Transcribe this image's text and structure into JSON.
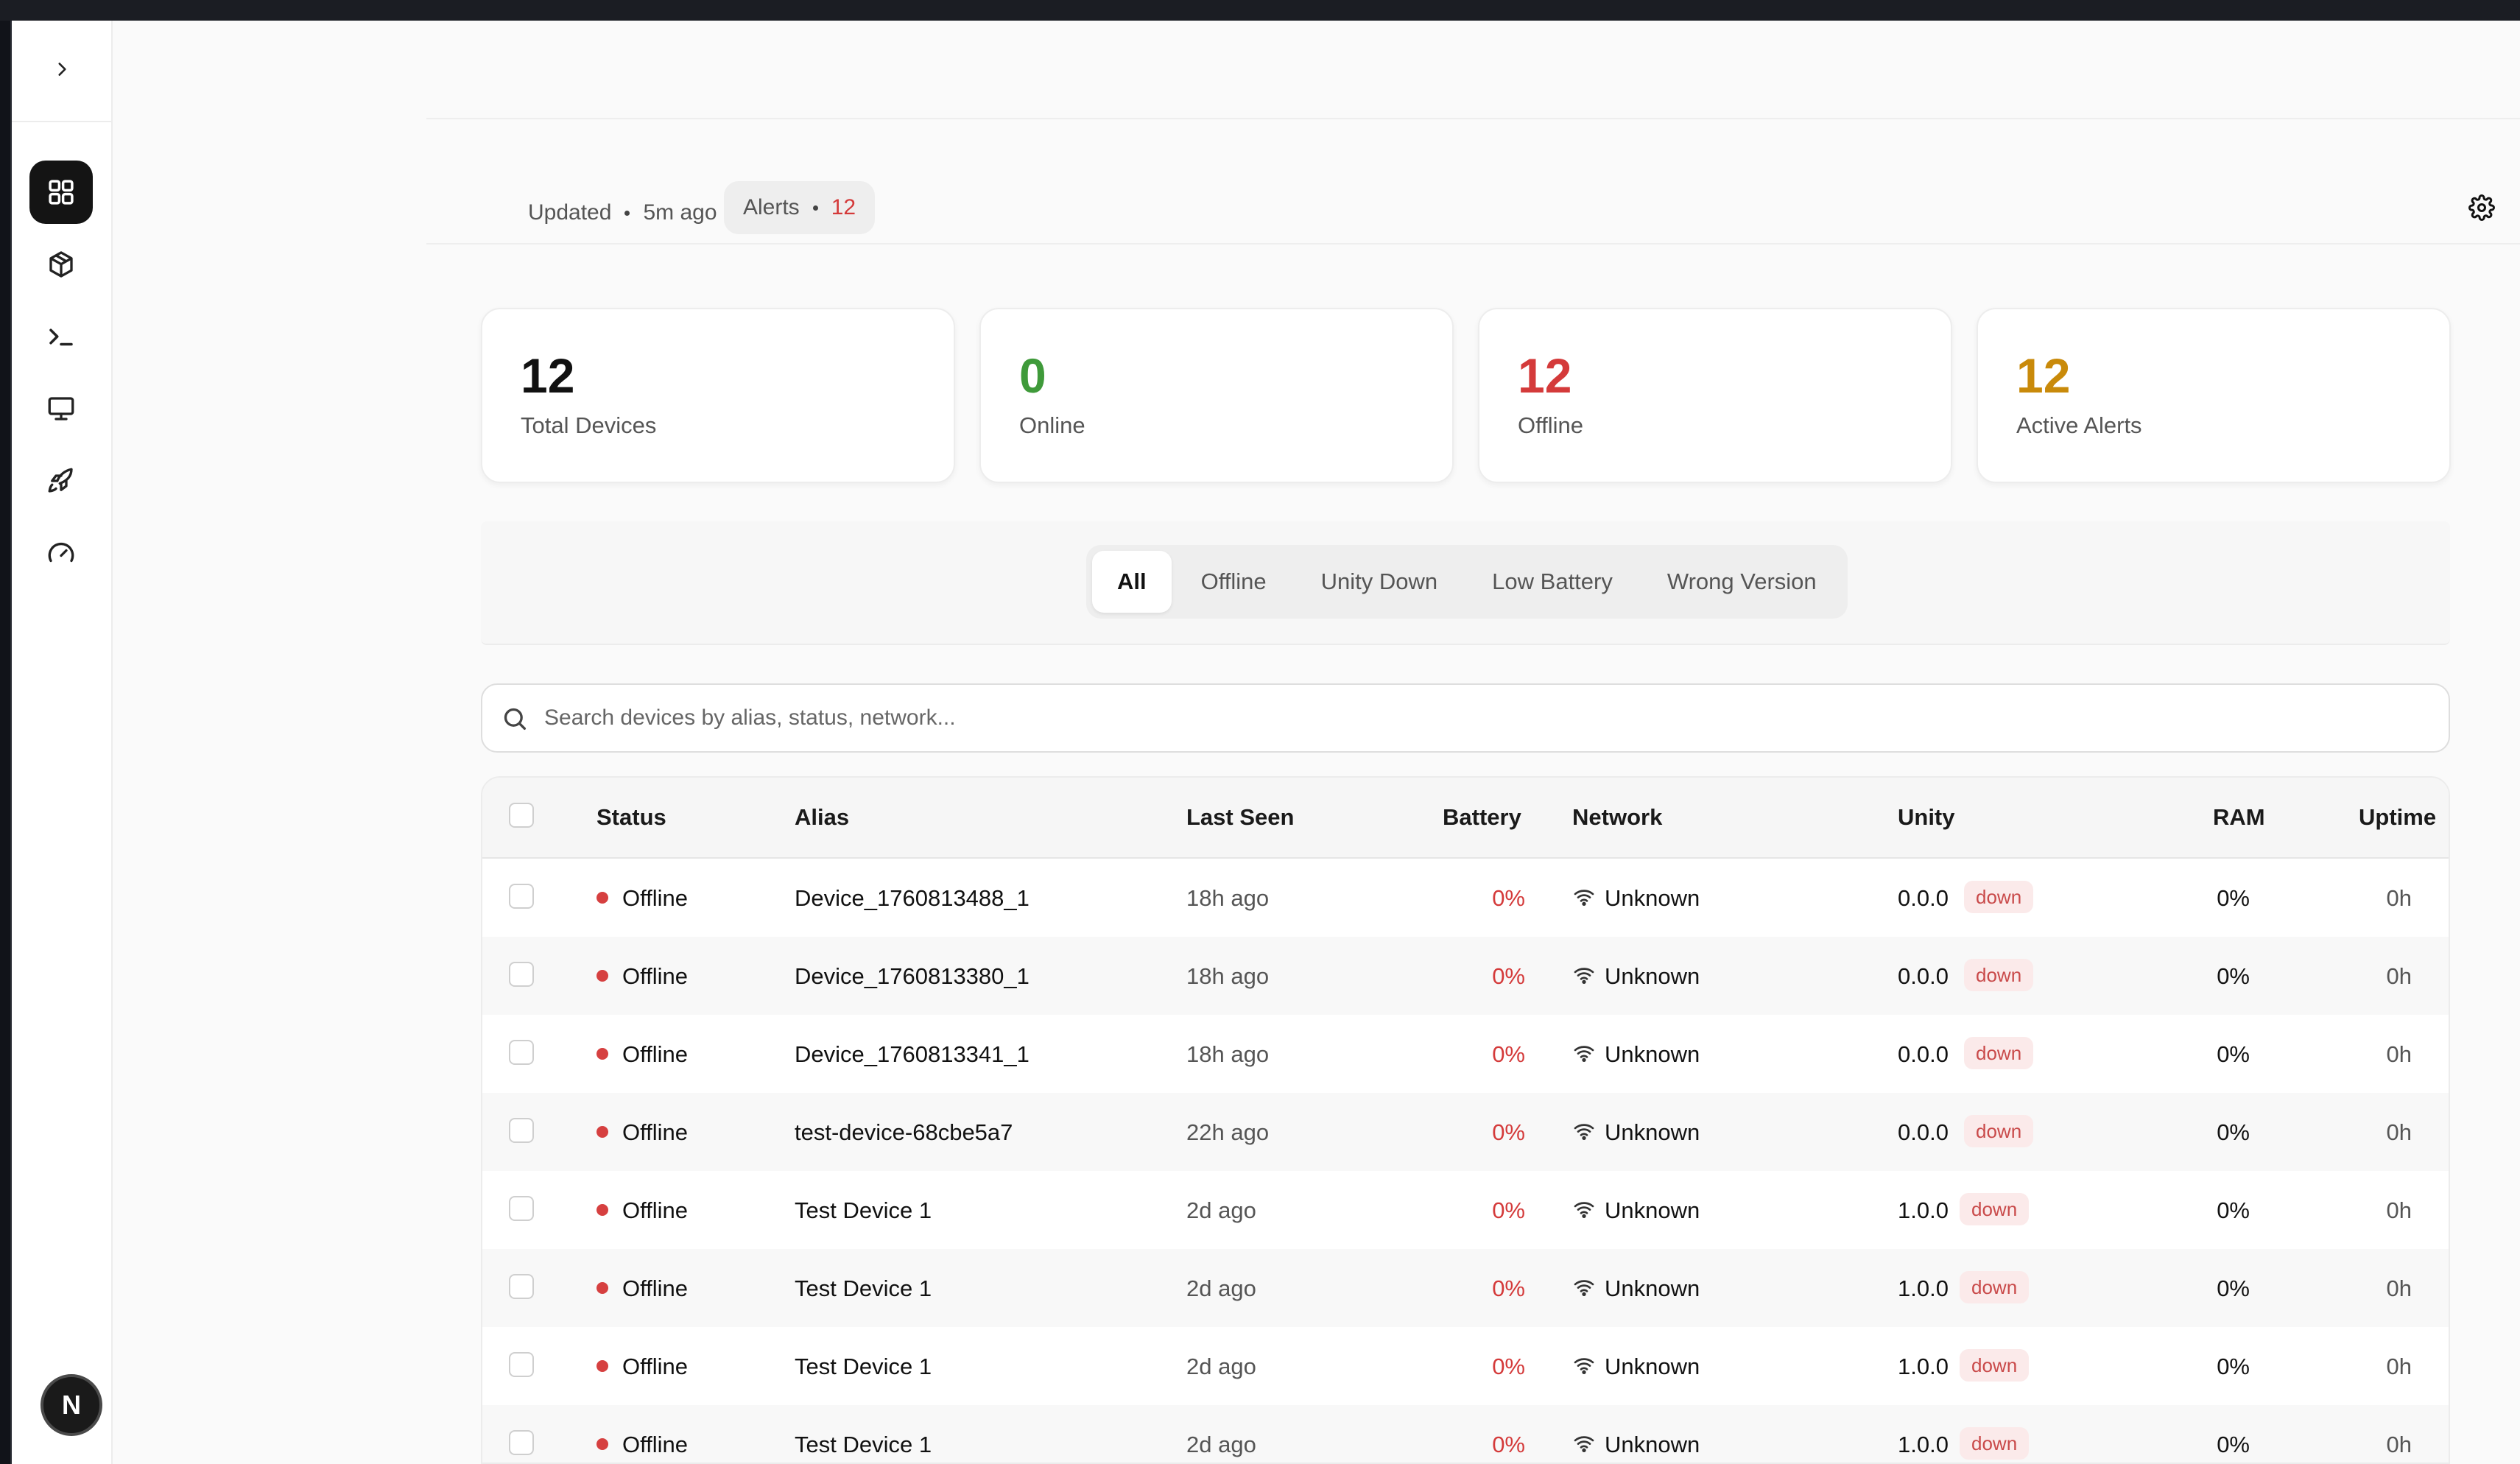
{
  "header": {
    "updated_label": "Updated",
    "updated_time": "5m ago",
    "alerts_label": "Alerts",
    "alerts_count": "12"
  },
  "stats": [
    {
      "value": "12",
      "label": "Total Devices",
      "color": "#111111"
    },
    {
      "value": "0",
      "label": "Online",
      "color": "#3f9a3a"
    },
    {
      "value": "12",
      "label": "Offline",
      "color": "#d43a3a"
    },
    {
      "value": "12",
      "label": "Active Alerts",
      "color": "#c98a0a"
    }
  ],
  "filters": [
    "All",
    "Offline",
    "Unity Down",
    "Low Battery",
    "Wrong Version"
  ],
  "active_filter": "All",
  "search": {
    "placeholder": "Search devices by alias, status, network..."
  },
  "table": {
    "columns": [
      "Status",
      "Alias",
      "Last Seen",
      "Battery",
      "Network",
      "Unity",
      "RAM",
      "Uptime"
    ],
    "rows": [
      {
        "status": "Offline",
        "alias": "Device_1760813488_1",
        "last_seen": "18h ago",
        "battery": "0%",
        "network": "Unknown",
        "unity": "0.0.0",
        "unity_state": "down",
        "ram": "0%",
        "uptime": "0h"
      },
      {
        "status": "Offline",
        "alias": "Device_1760813380_1",
        "last_seen": "18h ago",
        "battery": "0%",
        "network": "Unknown",
        "unity": "0.0.0",
        "unity_state": "down",
        "ram": "0%",
        "uptime": "0h"
      },
      {
        "status": "Offline",
        "alias": "Device_1760813341_1",
        "last_seen": "18h ago",
        "battery": "0%",
        "network": "Unknown",
        "unity": "0.0.0",
        "unity_state": "down",
        "ram": "0%",
        "uptime": "0h"
      },
      {
        "status": "Offline",
        "alias": "test-device-68cbe5a7",
        "last_seen": "22h ago",
        "battery": "0%",
        "network": "Unknown",
        "unity": "0.0.0",
        "unity_state": "down",
        "ram": "0%",
        "uptime": "0h"
      },
      {
        "status": "Offline",
        "alias": "Test Device 1",
        "last_seen": "2d ago",
        "battery": "0%",
        "network": "Unknown",
        "unity": "1.0.0",
        "unity_state": "down",
        "ram": "0%",
        "uptime": "0h"
      },
      {
        "status": "Offline",
        "alias": "Test Device 1",
        "last_seen": "2d ago",
        "battery": "0%",
        "network": "Unknown",
        "unity": "1.0.0",
        "unity_state": "down",
        "ram": "0%",
        "uptime": "0h"
      },
      {
        "status": "Offline",
        "alias": "Test Device 1",
        "last_seen": "2d ago",
        "battery": "0%",
        "network": "Unknown",
        "unity": "1.0.0",
        "unity_state": "down",
        "ram": "0%",
        "uptime": "0h"
      },
      {
        "status": "Offline",
        "alias": "Test Device 1",
        "last_seen": "2d ago",
        "battery": "0%",
        "network": "Unknown",
        "unity": "1.0.0",
        "unity_state": "down",
        "ram": "0%",
        "uptime": "0h"
      }
    ]
  },
  "sidebar": {
    "items": [
      {
        "icon": "dashboard-grid-icon",
        "active": true
      },
      {
        "icon": "package-box-icon",
        "active": false
      },
      {
        "icon": "terminal-icon",
        "active": false
      },
      {
        "icon": "monitor-icon",
        "active": false
      },
      {
        "icon": "rocket-icon",
        "active": false
      },
      {
        "icon": "gauge-icon",
        "active": false
      }
    ],
    "avatar_initial": "N"
  }
}
